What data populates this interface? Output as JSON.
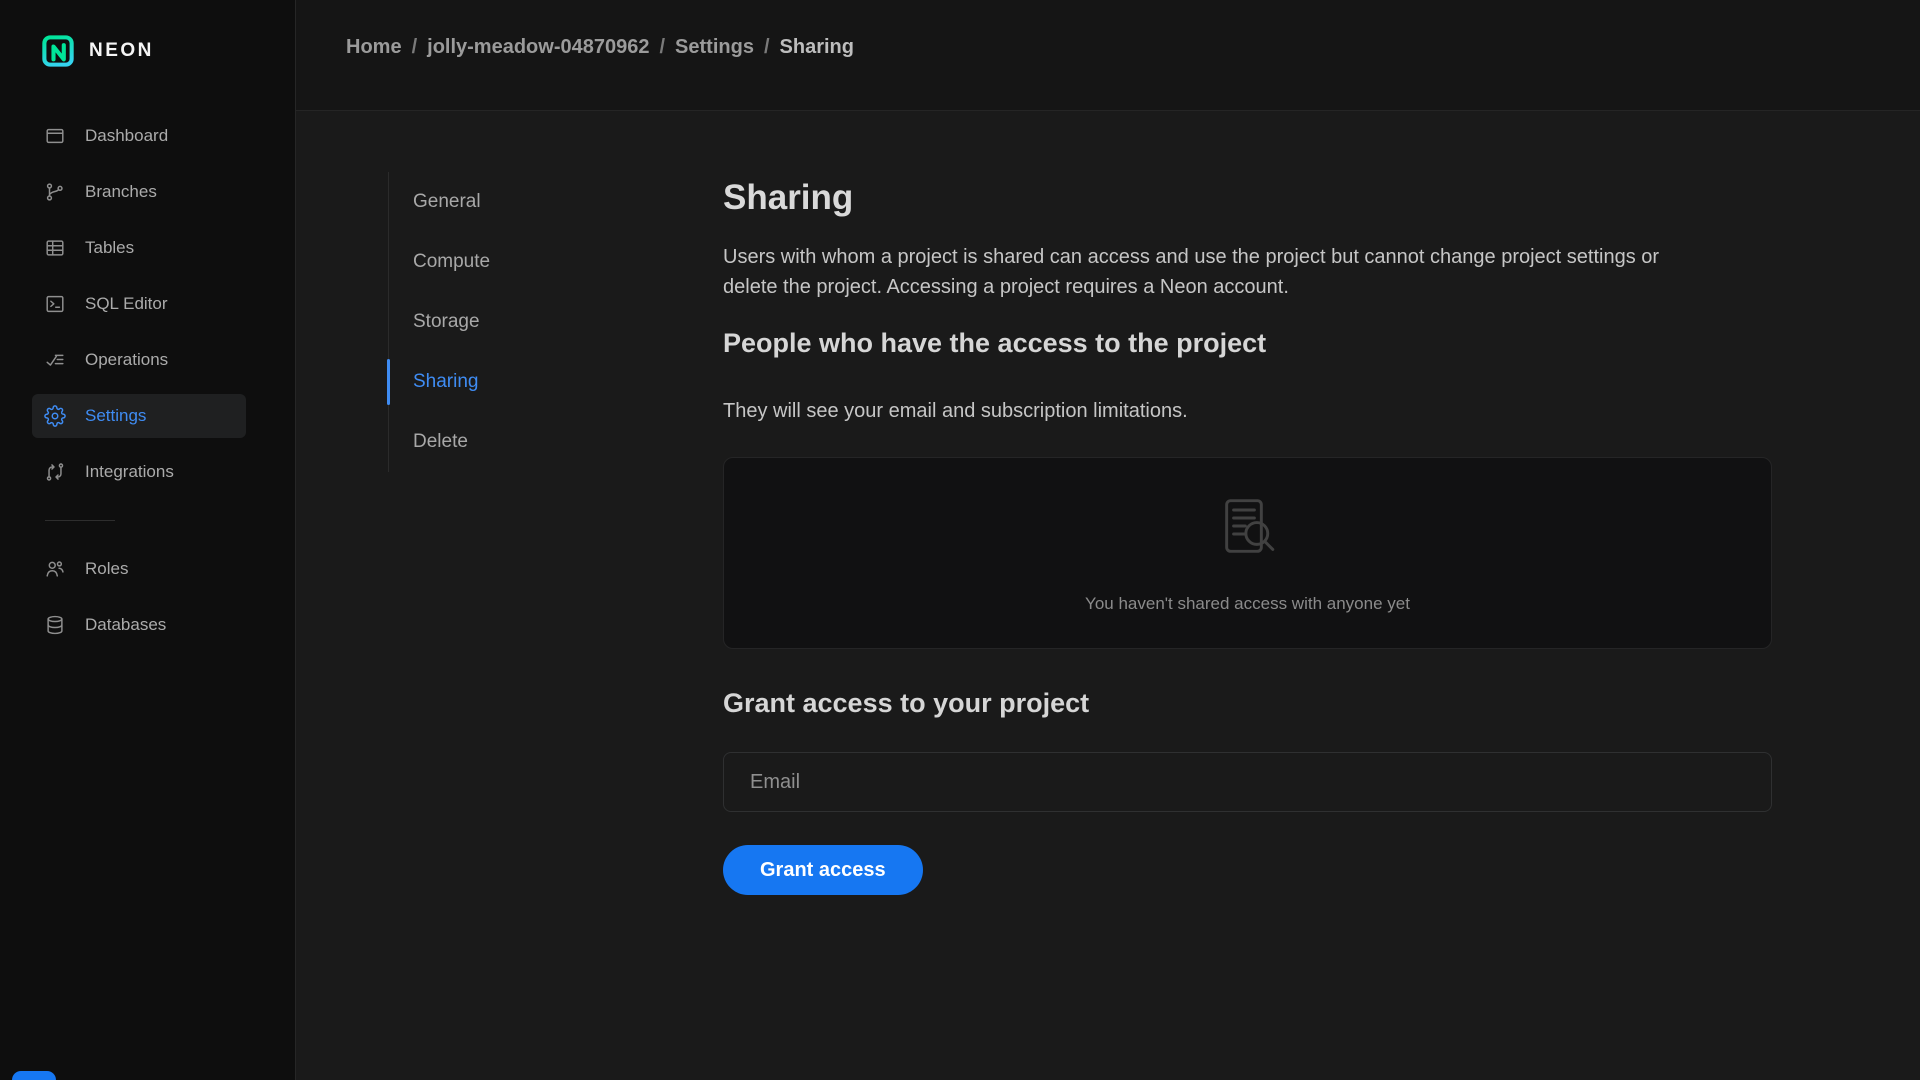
{
  "colors": {
    "accent_blue": "#1677f2",
    "link_blue": "#3f8cf3",
    "logo_green": "#00e599",
    "logo_cyan": "#35d4ef",
    "sidebar_bg": "#0e0e0e",
    "content_bg": "#1a1a1a"
  },
  "brand": {
    "name": "NEON"
  },
  "breadcrumb": {
    "separator": "/",
    "items": [
      "Home",
      "jolly-meadow-04870962",
      "Settings",
      "Sharing"
    ]
  },
  "sidebar": {
    "main_items": [
      {
        "label": "Dashboard",
        "icon": "dashboard-icon",
        "active": false
      },
      {
        "label": "Branches",
        "icon": "branches-icon",
        "active": false
      },
      {
        "label": "Tables",
        "icon": "tables-icon",
        "active": false
      },
      {
        "label": "SQL Editor",
        "icon": "sql-editor-icon",
        "active": false
      },
      {
        "label": "Operations",
        "icon": "operations-icon",
        "active": false
      },
      {
        "label": "Settings",
        "icon": "gear-icon",
        "active": true
      },
      {
        "label": "Integrations",
        "icon": "integrations-icon",
        "active": false
      }
    ],
    "secondary_items": [
      {
        "label": "Roles",
        "icon": "users-icon",
        "active": false
      },
      {
        "label": "Databases",
        "icon": "database-icon",
        "active": false
      }
    ]
  },
  "settings_nav": {
    "items": [
      {
        "label": "General",
        "active": false
      },
      {
        "label": "Compute",
        "active": false
      },
      {
        "label": "Storage",
        "active": false
      },
      {
        "label": "Sharing",
        "active": true
      },
      {
        "label": "Delete",
        "active": false
      }
    ]
  },
  "main": {
    "title": "Sharing",
    "description": "Users with whom a project is shared can access and use the project but cannot change project settings or delete the project. Accessing a project requires a Neon account.",
    "people_section": {
      "heading": "People who have the access to the project",
      "subtext": "They will see your email and subscription limitations.",
      "empty_state": {
        "icon": "document-search-icon",
        "message": "You haven't shared access with anyone yet"
      }
    },
    "grant_section": {
      "heading": "Grant access to your project",
      "email_placeholder": "Email",
      "button_label": "Grant access"
    }
  }
}
